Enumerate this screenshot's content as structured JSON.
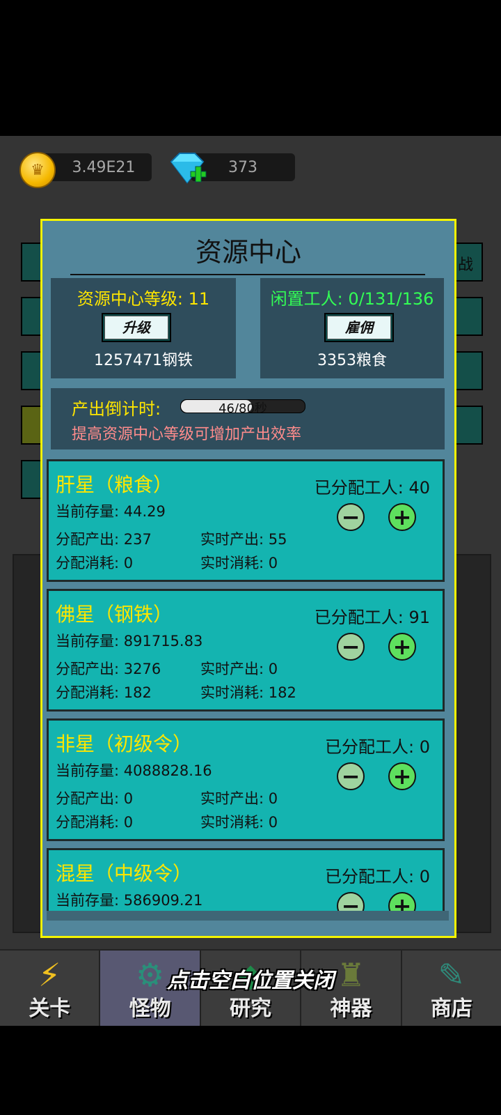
{
  "resources": {
    "coins": "3.49E21",
    "gems": "373"
  },
  "background_text": {
    "right_edge": "战"
  },
  "modal": {
    "title": "资源中心",
    "level_label": "资源中心等级: 11",
    "upgrade_button": "升级",
    "upgrade_cost": "1257471钢铁",
    "idle_workers": "闲置工人: 0/131/136",
    "hire_button": "雇佣",
    "hire_cost": "3353粮食",
    "countdown_label": "产出倒计时:",
    "countdown_progress": "46/80秒",
    "countdown_fraction": 0.575,
    "countdown_hint": "提高资源中心等级可增加产出效率",
    "planets": [
      {
        "name": "肝星（粮食）",
        "assigned": "已分配工人: 40",
        "stock": "当前存量: 44.29",
        "alloc_output": "分配产出: 237",
        "real_output": "实时产出: 55",
        "alloc_consume": "分配消耗: 0",
        "real_consume": "实时消耗: 0"
      },
      {
        "name": "佛星（钢铁）",
        "assigned": "已分配工人: 91",
        "stock": "当前存量: 891715.83",
        "alloc_output": "分配产出: 3276",
        "real_output": "实时产出: 0",
        "alloc_consume": "分配消耗: 182",
        "real_consume": "实时消耗: 182"
      },
      {
        "name": "非星（初级令）",
        "assigned": "已分配工人: 0",
        "stock": "当前存量: 4088828.16",
        "alloc_output": "分配产出: 0",
        "real_output": "实时产出: 0",
        "alloc_consume": "分配消耗: 0",
        "real_consume": "实时消耗: 0"
      },
      {
        "name": "混星（中级令）",
        "assigned": "已分配工人: 0",
        "stock": "当前存量: 586909.21"
      }
    ]
  },
  "close_hint": "点击空白位置关闭",
  "tabs": [
    {
      "label": "关卡",
      "icon": "lightning-icon"
    },
    {
      "label": "怪物",
      "icon": "gear-icon"
    },
    {
      "label": "研究",
      "icon": "research-icon"
    },
    {
      "label": "神器",
      "icon": "artifact-icon"
    },
    {
      "label": "商店",
      "icon": "shop-icon"
    }
  ]
}
